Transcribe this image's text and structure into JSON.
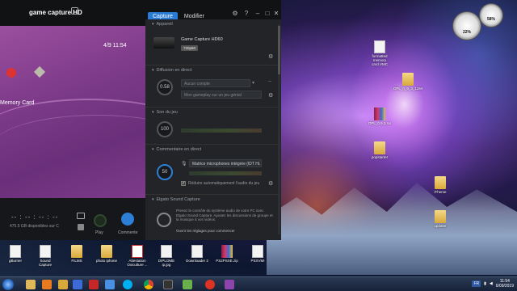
{
  "app": {
    "brand": "game capture HD",
    "tabs": [
      {
        "label": "Capture"
      },
      {
        "label": "Modifier"
      }
    ]
  },
  "preview": {
    "clock": "4/9 11:54",
    "memory_card_label": "Memory Card"
  },
  "controls": {
    "time_readout": "-- : -- : -- : --",
    "disk_space": "475.5 GB disponibles sur C",
    "play_label": "Play",
    "comment_label": "Commente"
  },
  "panel": {
    "device": {
      "title": "Appareil",
      "name": "Game Capture HD60",
      "badge": "720p60"
    },
    "live": {
      "title": "Diffusion en direct",
      "knob": "0.58",
      "service_placeholder": "Aucun compte",
      "title_placeholder": "Mon gameplay sur un jeu génial"
    },
    "game_audio": {
      "title": "Son du jeu",
      "knob": "100"
    },
    "commentary": {
      "title": "Commentaire en direct",
      "knob": "50",
      "mic": "Matrice microphones intégrée (IDT Hi...",
      "reduce_label": "Réduire automatiquement l'audio du jeu"
    },
    "sound_capture": {
      "title": "Elgato Sound Capture",
      "description": "Prenez le contrôle du système audio de votre PC avec Elgato Sound Capture. Ajoutez les discussions de groupe et la musique à vos vidéos.",
      "link": "Ouvrir les réglages pour commencer"
    }
  },
  "gadgets": [
    {
      "value": "22%"
    },
    {
      "value": "58%"
    }
  ],
  "desktop_icons": [
    {
      "label": "formatted memory card.VMC",
      "kind": "doc"
    },
    {
      "label": "OPL_0_9_3_1194",
      "kind": "folder"
    },
    {
      "label": "OPL_0.9.3.rar",
      "kind": "rar"
    },
    {
      "label": "popstarter",
      "kind": "folder"
    },
    {
      "label": "iTheme",
      "kind": "folder"
    },
    {
      "label": "updater",
      "kind": "folder"
    }
  ],
  "bottom_icons": [
    {
      "label": "gBurner",
      "kind": "doc"
    },
    {
      "label": "Sound Capture",
      "kind": "doc"
    },
    {
      "label": "FILMS",
      "kind": "folder"
    },
    {
      "label": "photo iphone",
      "kind": "folder"
    },
    {
      "label": "Attestation Oxiculture ...",
      "kind": "pdf"
    },
    {
      "label": "DIPLOME ip.jpg",
      "kind": "doc"
    },
    {
      "label": "Downloader 2",
      "kind": "doc"
    },
    {
      "label": "PS2PSXE.zip",
      "kind": "rar"
    },
    {
      "label": "PSXVMI",
      "kind": "doc"
    }
  ],
  "taskbar": {
    "time": "11:54",
    "date": "6/09/2019",
    "lang": "FR"
  }
}
